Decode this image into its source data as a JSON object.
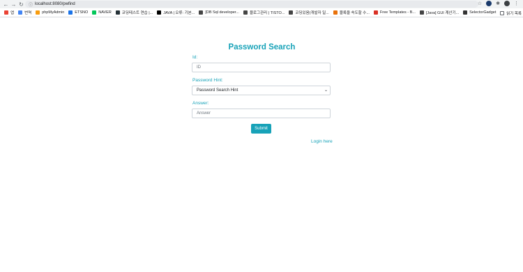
{
  "browser": {
    "url": "localhost:8080/pwfind",
    "bookmarks": [
      {
        "label": "앱",
        "color": "#ea4335"
      },
      {
        "label": "번역",
        "color": "#4285f4"
      },
      {
        "label": "phpMyAdmin",
        "color": "#f89c0e"
      },
      {
        "label": "ETSNO",
        "color": "#1a73e8"
      },
      {
        "label": "NAVER",
        "color": "#03c75a"
      },
      {
        "label": "코딩테스트 연습 |...",
        "color": "#263238"
      },
      {
        "label": "JAVA | 오류: 기본...",
        "color": "#000000"
      },
      {
        "label": "[DB Sql developer...",
        "color": "#444444"
      },
      {
        "label": "블로그관리 | TISTO...",
        "color": "#444444"
      },
      {
        "label": "코딩있음(개발자 일...",
        "color": "#444444"
      },
      {
        "label": "블록을 속도할 수...",
        "color": "#e8710a"
      },
      {
        "label": "Free Templates - B...",
        "color": "#d93025"
      },
      {
        "label": "[Java] GUI 계산기...",
        "color": "#444444"
      },
      {
        "label": "SelectorGadget",
        "color": "#333333"
      }
    ],
    "reading_list": "읽기 목록"
  },
  "form": {
    "title": "Password Search",
    "id_label": "Id:",
    "id_placeholder": "ID",
    "hint_label": "Password Hint:",
    "hint_selected": "Password Search Hint",
    "answer_label": "Answer:",
    "answer_placeholder": "Answer",
    "submit_label": "Submit",
    "login_link": "Login here"
  },
  "colors": {
    "accent": "#17a2b8"
  }
}
